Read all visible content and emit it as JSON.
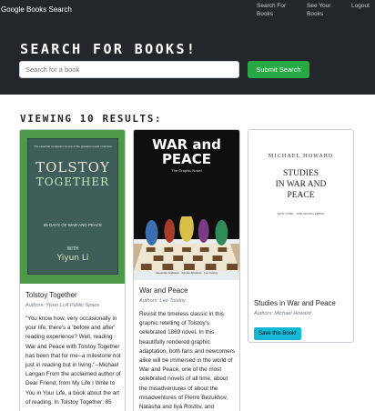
{
  "navbar": {
    "brand": "Google Books Search",
    "links": [
      "Search For Books",
      "See Your Books",
      "Logout"
    ]
  },
  "hero": {
    "title": "Search For Books!",
    "search_placeholder": "Search for a book",
    "submit_label": "Submit Search"
  },
  "results": {
    "heading": "Viewing 10 Results:",
    "books": [
      {
        "title": "Tolstoy Together",
        "authors": "Authors: Yiyun Li;A Public Space",
        "description": "\"You know how, very occasionally in your life, there's a 'before and after' reading experience? Well, reading War and Peace with Tolstoy Together has been that for me--a milestone not just in reading but in living.\"--Michael Langan From the acclaimed author of Dear Friend, from My Life I Write to You in Your Life, a book about the art of reading. In Tolstoy Together: 85",
        "cover": {
          "top_text": "The essential companion to one of the greatest novels of all time",
          "title_line1": "TOLSTOY",
          "title_line2": "TOGETHER",
          "subtitle": "85 DAYS OF WAR AND PEACE",
          "with": "WITH",
          "author": "Yiyun Li"
        }
      },
      {
        "title": "War and Peace",
        "authors": "Authors: Leo Tolstoy",
        "description": "Revisit the timeless classic in this graphic retelling of Tolstoy's celebrated 1869 novel. In this beautifully rendered graphic adaptation, both fans and newcomers alike will be immersed in the world of War and Peace, one of the most celebrated novels of all time, about the misadventures of about the misadventures of Pierre Bezukhov, Natásha and Ilyá Rostóv, and company during the",
        "cover": {
          "title_line1": "WAR and",
          "title_line2": "PEACE",
          "subtitle": "The Graphic Novel",
          "credits": "Alexander Nabokov · Kestas Bhushan · Leo Tolstoy"
        }
      },
      {
        "title": "Studies in War and Peace",
        "authors": "Authors: Michael Howard",
        "save_label": "Save this Book!",
        "cover": {
          "author": "MICHAEL HOWARD",
          "title_line1": "STUDIES",
          "title_line2": "IN WAR AND",
          "title_line3": "PEACE",
          "publisher": "NEW YORK · THE VIKING PRESS"
        }
      }
    ]
  },
  "colors": {
    "navbar_bg": "#23272b",
    "submit_green": "#28a745",
    "save_cyan": "#17b7d6",
    "card1_cover_green": "#4f9a4a"
  }
}
